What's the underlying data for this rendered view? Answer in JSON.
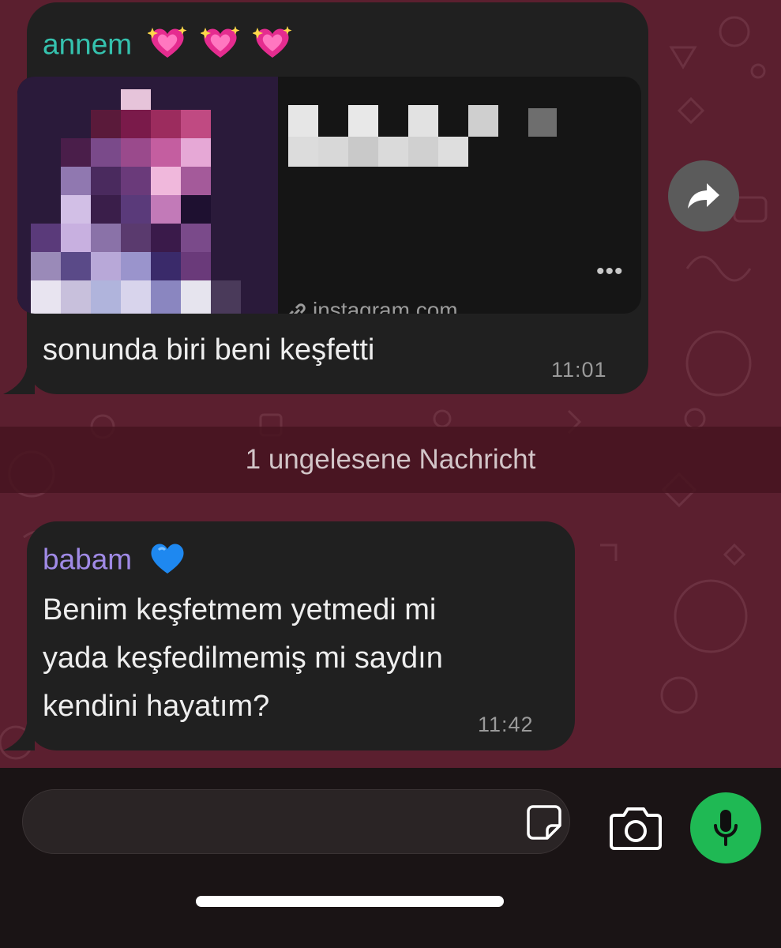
{
  "colors": {
    "chat_background": "#5b1f2f",
    "bubble": "#202020",
    "sender1": "#35c2ae",
    "sender2": "#a08ae6",
    "mic_button": "#1fb954"
  },
  "messages": [
    {
      "sender": "annem",
      "sender_emojis": [
        "sparkling-heart-emoji",
        "sparkling-heart-emoji",
        "sparkling-heart-emoji"
      ],
      "link_preview": {
        "domain": "instagram.com",
        "more": "•••"
      },
      "text": "sonunda biri beni keşfetti",
      "time": "11:01"
    },
    {
      "sender": "babam",
      "sender_emojis": [
        "blue-heart-emoji"
      ],
      "text": "Benim keşfetmem yetmedi mi\nyada keşfedilmemiş mi saydın\nkendini hayatım?",
      "time": "11:42"
    }
  ],
  "unread_banner": "1 ungelesene Nachricht",
  "input": {
    "placeholder": ""
  },
  "icons": {
    "forward": "forward-arrow-icon",
    "sticker": "sticker-icon",
    "camera": "camera-icon",
    "mic": "microphone-icon",
    "link": "link-icon"
  }
}
